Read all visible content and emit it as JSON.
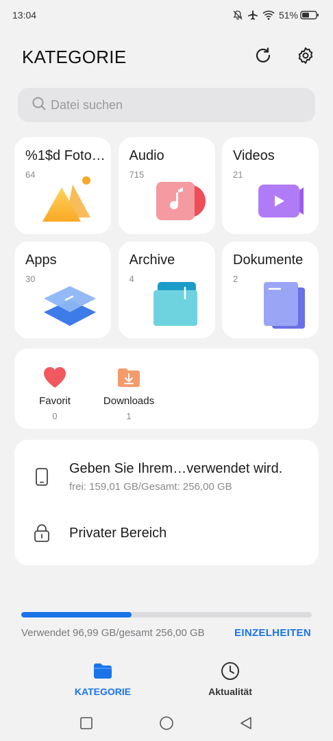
{
  "status_bar": {
    "time": "13:04",
    "battery_percent": "51%",
    "icons": [
      "mute-icon",
      "airplane-icon",
      "wifi-icon",
      "battery-icon"
    ]
  },
  "header": {
    "title": "KATEGORIE",
    "actions": [
      "refresh-icon",
      "settings-icon"
    ]
  },
  "search": {
    "placeholder": "Datei suchen"
  },
  "categories": [
    {
      "label": "%1$d Foto…",
      "count": "64"
    },
    {
      "label": "Audio",
      "count": "715"
    },
    {
      "label": "Videos",
      "count": "21"
    },
    {
      "label": "Apps",
      "count": "30"
    },
    {
      "label": "Archive",
      "count": "4"
    },
    {
      "label": "Dokumente",
      "count": "2"
    }
  ],
  "shortcuts": [
    {
      "label": "Favorit",
      "count": "0",
      "icon": "heart-icon"
    },
    {
      "label": "Downloads",
      "count": "1",
      "icon": "download-folder-icon"
    }
  ],
  "storage": {
    "internal": {
      "title": "Geben Sie Ihrem…verwendet wird.",
      "subtitle": "frei: 159,01 GB/Gesamt: 256,00 GB",
      "icon": "phone-icon"
    },
    "private": {
      "title": "Privater Bereich",
      "icon": "lock-icon"
    }
  },
  "usage": {
    "text": "Verwendet 96,99 GB/gesamt 256,00 GB",
    "fraction": 0.379,
    "details_label": "EINZELHEITEN"
  },
  "tabs": [
    {
      "label": "KATEGORIE",
      "icon": "folder-icon",
      "active": true
    },
    {
      "label": "Aktualität",
      "icon": "clock-icon",
      "active": false
    }
  ],
  "colors": {
    "accent": "#1a73e8",
    "background": "#f2f2f3"
  }
}
